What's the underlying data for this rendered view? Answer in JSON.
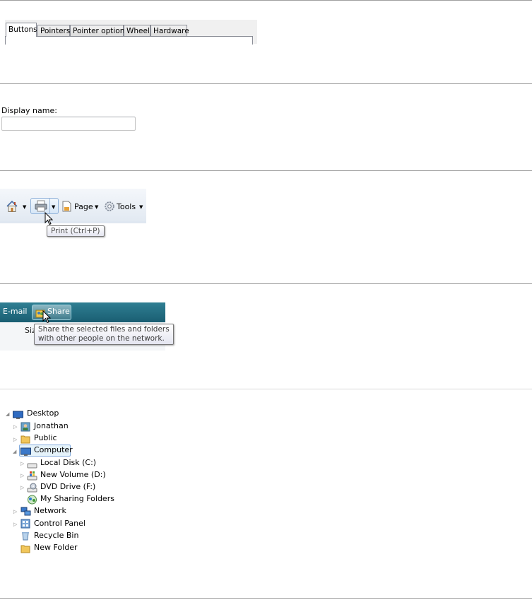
{
  "tabs": {
    "items": [
      "Buttons",
      "Pointers",
      "Pointer options",
      "Wheel",
      "Hardware"
    ],
    "active_index": 0
  },
  "display_name": {
    "label": "Display name:",
    "value": ""
  },
  "ie_toolbar": {
    "home_icon": "home-icon",
    "print_icon": "print-icon",
    "page_label": "Page",
    "tools_label": "Tools",
    "dropdown_glyph": "▼",
    "tooltip": "Print (Ctrl+P)"
  },
  "explorer_bar": {
    "email_label": "E-mail",
    "share_label": "Share",
    "column_label": "Siz",
    "tooltip_line1": "Share the selected files and folders",
    "tooltip_line2": "with other people on the network."
  },
  "tree": {
    "desktop": "Desktop",
    "jonathan": "Jonathan",
    "public": "Public",
    "computer": "Computer",
    "local_disk": "Local Disk (C:)",
    "new_volume": "New Volume (D:)",
    "dvd_drive": "DVD Drive (F:)",
    "sharing_folders": "My Sharing Folders",
    "network": "Network",
    "control_panel": "Control Panel",
    "recycle_bin": "Recycle Bin",
    "new_folder": "New Folder"
  },
  "colors": {
    "separator": "#a0a0a0",
    "command_bar": "#1f6b80",
    "selection": "#e5f3fb"
  }
}
